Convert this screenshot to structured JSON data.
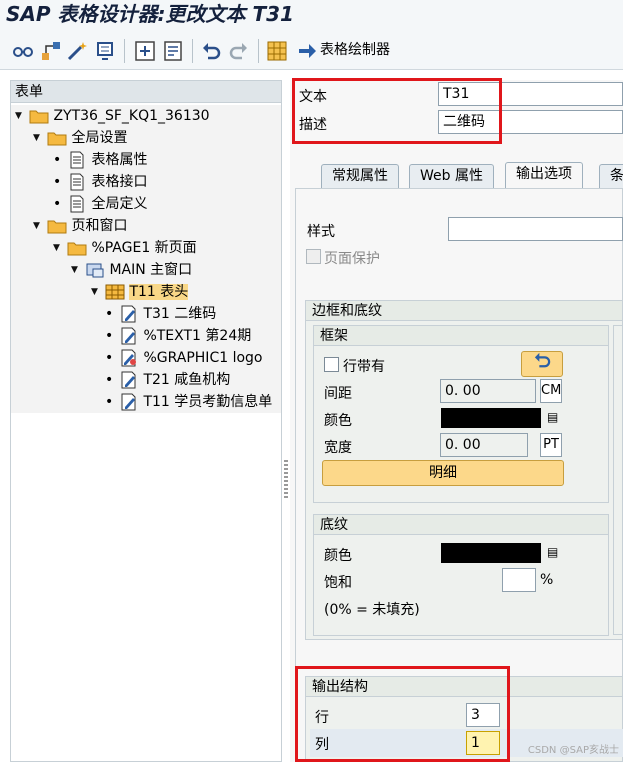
{
  "window": {
    "title": "SAP 表格设计器:更改文本 T31"
  },
  "toolbar": {
    "form_painter_label": "表格绘制器"
  },
  "tree": {
    "header": "表单",
    "nodes": [
      {
        "label": "ZYT36_SF_KQ1_36130",
        "icon": "folder-icon",
        "level": 0,
        "kind": "tri"
      },
      {
        "label": "全局设置",
        "icon": "folder-icon",
        "level": 1,
        "kind": "tri"
      },
      {
        "label": "表格属性",
        "icon": "document-icon",
        "level": 2,
        "kind": "dot"
      },
      {
        "label": "表格接口",
        "icon": "document-icon",
        "level": 2,
        "kind": "dot"
      },
      {
        "label": "全局定义",
        "icon": "document-icon",
        "level": 2,
        "kind": "dot"
      },
      {
        "label": "页和窗口",
        "icon": "folder-icon",
        "level": 1,
        "kind": "tri"
      },
      {
        "label": "%PAGE1 新页面",
        "icon": "folder-icon",
        "level": 2,
        "kind": "tri"
      },
      {
        "label": "MAIN 主窗口",
        "icon": "window-icon",
        "level": 3,
        "kind": "tri"
      },
      {
        "label": "T11 表头",
        "icon": "table-icon",
        "level": 4,
        "kind": "tri",
        "selected": true
      },
      {
        "label": "T31 二维码",
        "icon": "text-edit-icon",
        "level": 5,
        "kind": "dot"
      },
      {
        "label": "%TEXT1 第24期",
        "icon": "text-edit-icon",
        "level": 5,
        "kind": "dot"
      },
      {
        "label": "%GRAPHIC1 logo",
        "icon": "graphic-icon",
        "level": 5,
        "kind": "dot"
      },
      {
        "label": "T21 咸鱼机构",
        "icon": "text-edit-icon",
        "level": 5,
        "kind": "dot"
      },
      {
        "label": "T11 学员考勤信息单",
        "icon": "text-edit-icon",
        "level": 5,
        "kind": "dot"
      }
    ]
  },
  "header_fields": {
    "text_label": "文本",
    "text_value": "T31",
    "desc_label": "描述",
    "desc_value": "二维码"
  },
  "tabs": [
    "常规属性",
    "Web 属性",
    "输出选项",
    "条"
  ],
  "output_options": {
    "style_label": "样式",
    "page_protect_label": "页面保护",
    "borders_group": "边框和底纹",
    "frame_group": "框架",
    "frame_checkbox_label": "行带有",
    "spacing_label": "间距",
    "spacing_value": "0. 00",
    "spacing_unit": "CM",
    "color_label": "颜色",
    "width_label": "宽度",
    "width_value": "0. 00",
    "width_unit": "PT",
    "detail_button": "明细",
    "shading_group": "底纹",
    "shading_color_label": "颜色",
    "saturation_label": "饱和",
    "saturation_unit": "%",
    "shading_note": "(0% = 未填充)",
    "output_structure_group": "输出结构",
    "row_label": "行",
    "row_value": "3",
    "col_label": "列",
    "col_value": "1"
  },
  "watermark": "CSDN @SAP亥战士"
}
